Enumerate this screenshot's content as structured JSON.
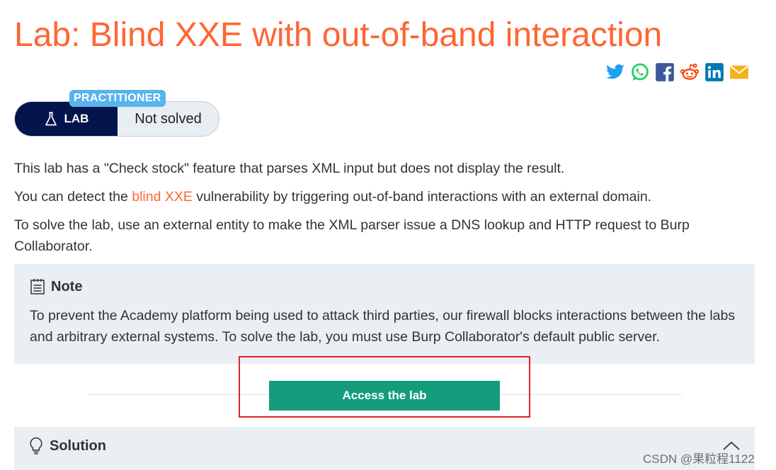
{
  "title": "Lab: Blind XXE with out-of-band interaction",
  "share": {
    "icons": [
      "twitter-icon",
      "whatsapp-icon",
      "facebook-icon",
      "reddit-icon",
      "linkedin-icon",
      "email-icon"
    ],
    "colors": {
      "twitter": "#1da1f2",
      "whatsapp": "#25d366",
      "facebook": "#3b5998",
      "reddit": "#ff4500",
      "linkedin": "#0077b5",
      "email": "#f5b01a"
    }
  },
  "lab_widget": {
    "level": "PRACTITIONER",
    "type_label": "LAB",
    "status": "Not solved"
  },
  "description": {
    "p1": "This lab has a \"Check stock\" feature that parses XML input but does not display the result.",
    "p2_before": "You can detect the ",
    "p2_link": "blind XXE",
    "p2_after": " vulnerability by triggering out-of-band interactions with an external domain.",
    "p3": "To solve the lab, use an external entity to make the XML parser issue a DNS lookup and HTTP request to Burp Collaborator."
  },
  "note": {
    "heading": "Note",
    "body": "To prevent the Academy platform being used to attack third parties, our firewall blocks interactions between the labs and arbitrary external systems. To solve the lab, you must use Burp Collaborator's default public server."
  },
  "access_button": "Access the lab",
  "solution": {
    "heading": "Solution"
  },
  "watermark": "CSDN @果粒程1122",
  "colors": {
    "accent": "#ff6633",
    "navy": "#04144d",
    "badge": "#58b4ee",
    "button": "#159c7d",
    "panel": "#e9eff2",
    "highlight_box": "#e0202a"
  }
}
